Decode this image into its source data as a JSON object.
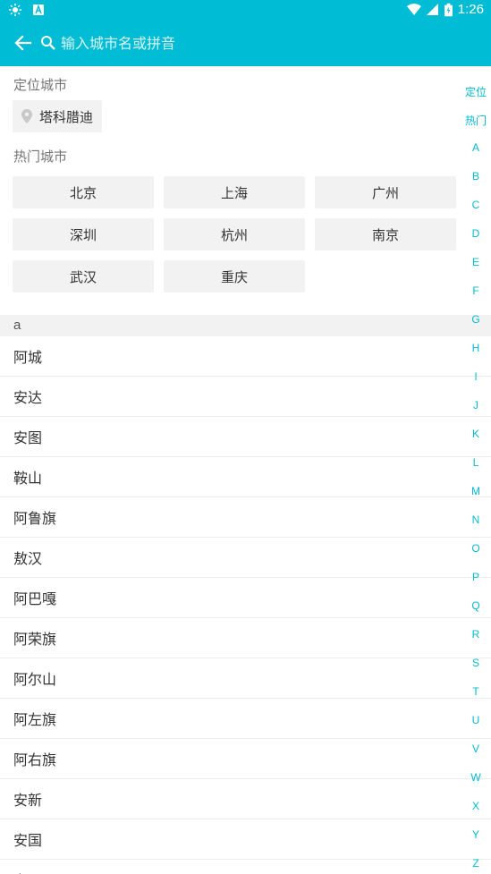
{
  "status_bar": {
    "time": "1:26",
    "icons": [
      "brightness-icon",
      "a-badge-icon",
      "wifi-icon",
      "signal-icon",
      "battery-icon"
    ]
  },
  "header": {
    "back_icon": "arrow-left-icon",
    "search_icon": "search-icon",
    "search_placeholder": "输入城市名或拼音",
    "search_value": ""
  },
  "located": {
    "title": "定位城市",
    "city": "塔科腊迪",
    "icon": "location-pin-icon"
  },
  "hot": {
    "title": "热门城市",
    "cities": [
      "北京",
      "上海",
      "广州",
      "深圳",
      "杭州",
      "南京",
      "武汉",
      "重庆"
    ]
  },
  "list": {
    "letter": "a",
    "cities": [
      "阿城",
      "安达",
      "安图",
      "鞍山",
      "阿鲁旗",
      "敖汉",
      "阿巴嘎",
      "阿荣旗",
      "阿尔山",
      "阿左旗",
      "阿右旗",
      "安新",
      "安国",
      "安平"
    ]
  },
  "index_bar": [
    "定位",
    "热门",
    "A",
    "B",
    "C",
    "D",
    "E",
    "F",
    "G",
    "H",
    "I",
    "J",
    "K",
    "L",
    "M",
    "N",
    "O",
    "P",
    "Q",
    "R",
    "S",
    "T",
    "U",
    "V",
    "W",
    "X",
    "Y",
    "Z"
  ],
  "colors": {
    "accent": "#00bcd4",
    "chip_bg": "#f2f2f2",
    "text": "#333333",
    "secondary_text": "#757575"
  }
}
